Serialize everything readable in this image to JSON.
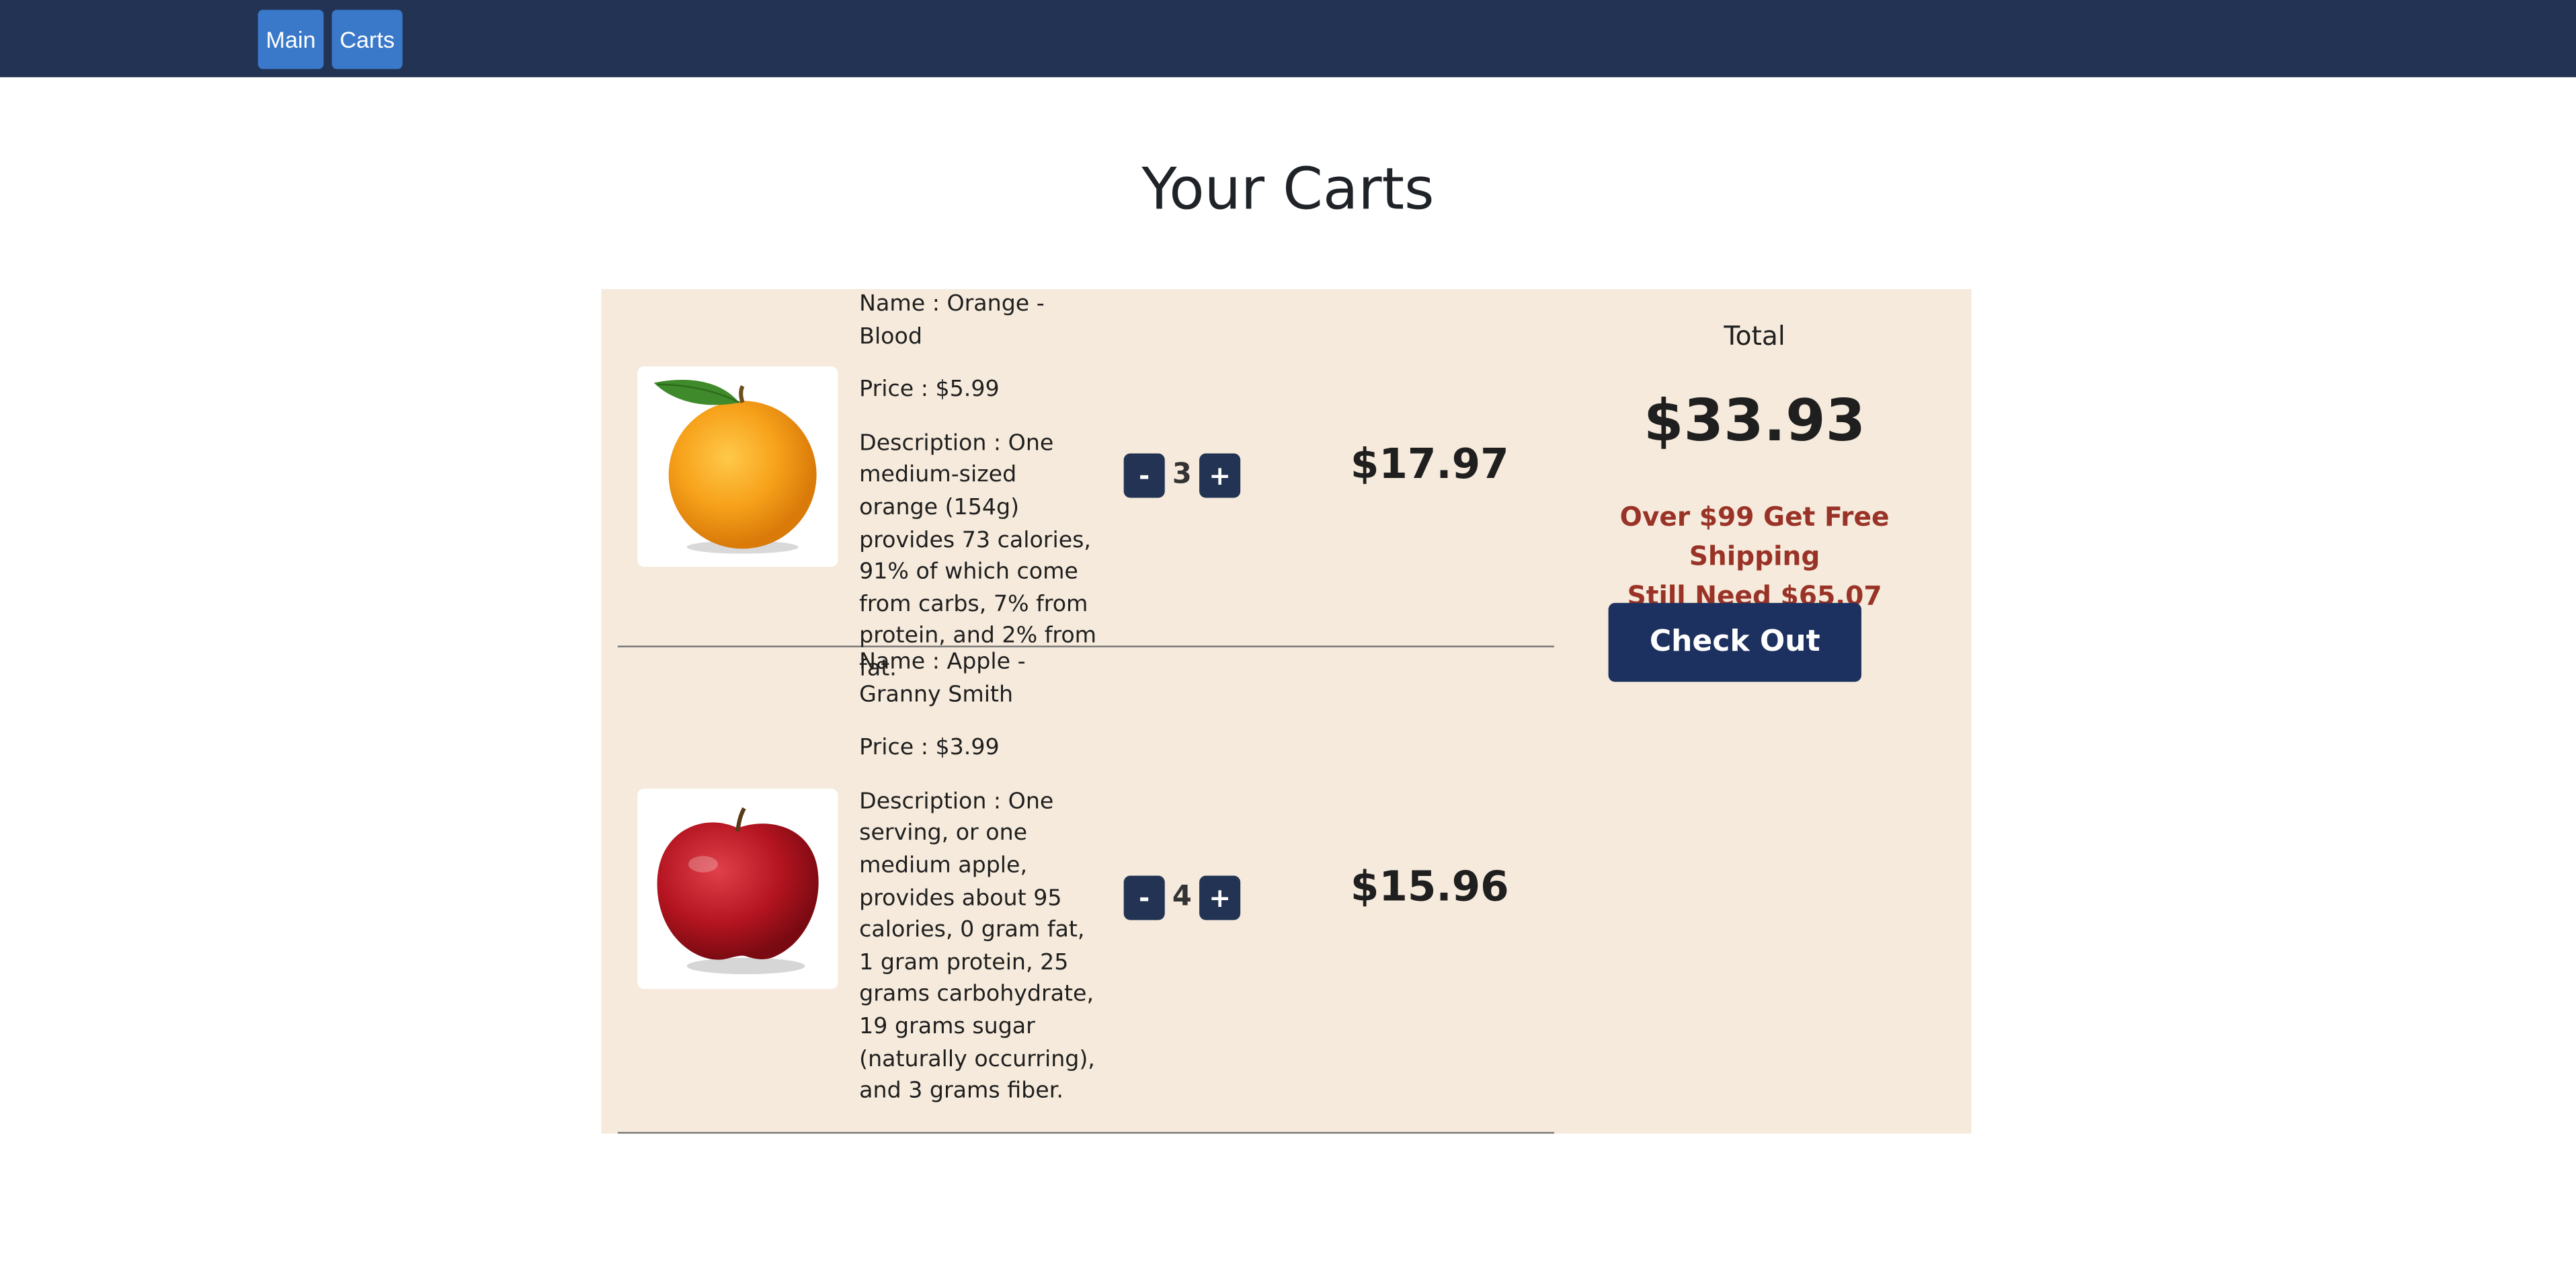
{
  "nav": {
    "main_label": "Main",
    "carts_label": "Carts"
  },
  "page": {
    "title": "Your Carts"
  },
  "cart": {
    "items": [
      {
        "name": "Name : Orange - Blood",
        "price": "Price : $5.99",
        "description": "Description : One medium-sized orange (154g) provides 73 calories, 91% of which come from carbs, 7% from protein, and 2% from fat.",
        "quantity": "3",
        "minus_label": "-",
        "plus_label": "+",
        "line_total": "$17.97",
        "image_icon": "orange-image"
      },
      {
        "name": "Name : Apple - Granny Smith",
        "price": "Price : $3.99",
        "description": "Description : One serving, or one medium apple, provides about 95 calories, 0 gram fat, 1 gram protein, 25 grams carbohydrate, 19 grams sugar (naturally occurring), and 3 grams fiber.",
        "quantity": "4",
        "minus_label": "-",
        "plus_label": "+",
        "line_total": "$15.96",
        "image_icon": "apple-image"
      }
    ]
  },
  "summary": {
    "label": "Total",
    "total": "$33.93",
    "shipping_line1": "Over $99 Get Free Shipping",
    "shipping_line2": "Still Need $65.07",
    "checkout_label": "Check Out"
  },
  "colors": {
    "navbar": "#233353",
    "nav_button": "#3a78c9",
    "panel": "#f5eadb",
    "qty_button": "#233353",
    "checkout": "#1d3160",
    "shipping_text": "#9a3327"
  }
}
